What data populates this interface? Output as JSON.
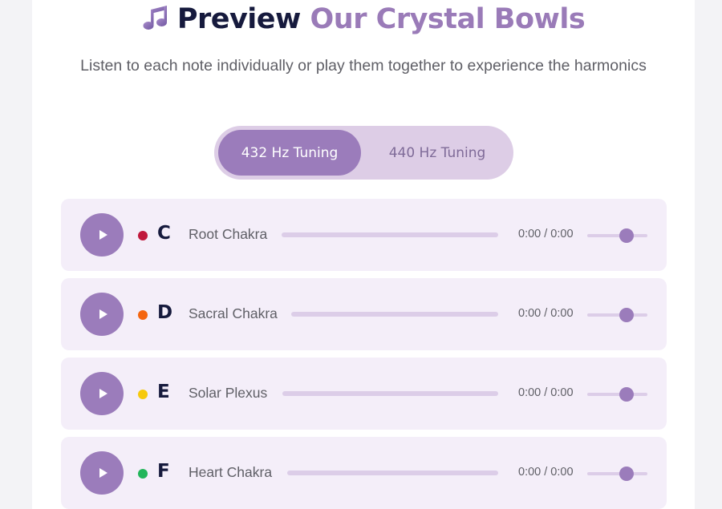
{
  "header": {
    "icon": "music-notes-icon",
    "title_part1": "Preview",
    "title_part2": "Our Crystal Bowls",
    "subtitle": "Listen to each note individually or play them together to experience the harmonics"
  },
  "tuning": {
    "options": [
      {
        "label": "432 Hz Tuning",
        "active": true
      },
      {
        "label": "440 Hz Tuning",
        "active": false
      }
    ]
  },
  "colors": {
    "accent": "#9b7cbb",
    "title_dark": "#161a3d",
    "row_bg": "#f4eef9"
  },
  "bowls": [
    {
      "note": "C",
      "chakra": "Root Chakra",
      "dot_color": "#c0183c",
      "time": "0:00 / 0:00",
      "progress": 0,
      "volume": 0.65
    },
    {
      "note": "D",
      "chakra": "Sacral Chakra",
      "dot_color": "#f4650f",
      "time": "0:00 / 0:00",
      "progress": 0,
      "volume": 0.65
    },
    {
      "note": "E",
      "chakra": "Solar Plexus",
      "dot_color": "#f6c90c",
      "time": "0:00 / 0:00",
      "progress": 0,
      "volume": 0.65
    },
    {
      "note": "F",
      "chakra": "Heart Chakra",
      "dot_color": "#22b55a",
      "time": "0:00 / 0:00",
      "progress": 0,
      "volume": 0.65
    }
  ]
}
